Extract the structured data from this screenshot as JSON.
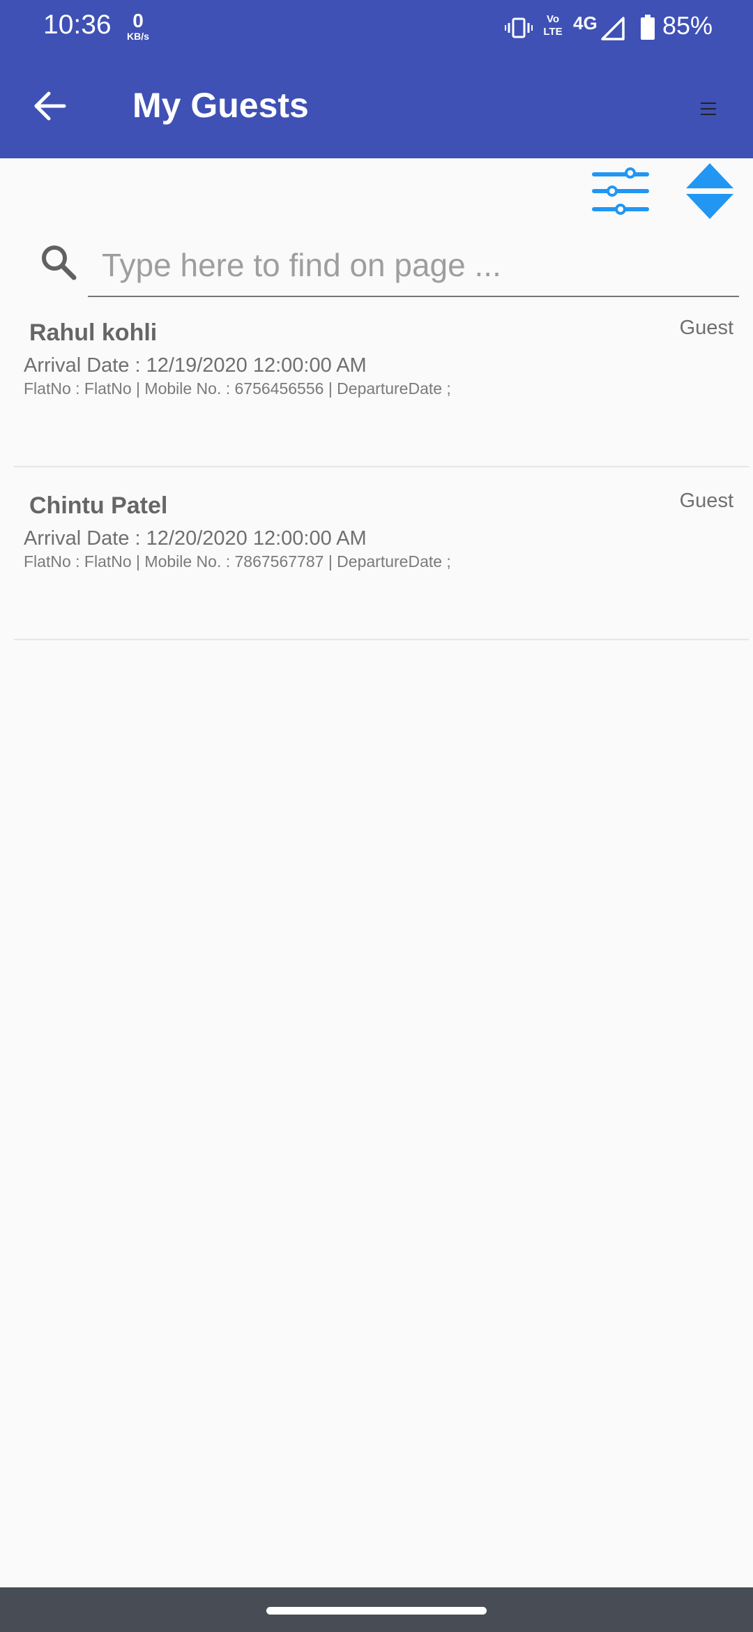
{
  "status_bar": {
    "time": "10:36",
    "net_speed_value": "0",
    "net_speed_unit": "KB/s",
    "volte_top": "Vo",
    "volte_bottom": "LTE",
    "network_type": "4G",
    "battery_percent": "85%"
  },
  "app_bar": {
    "title": "My Guests",
    "background_color": "#3f51b5"
  },
  "toolbar": {
    "filter_icon": "filter-sliders-icon",
    "sort_icon": "sort-updown-icon",
    "accent_color": "#2196f3"
  },
  "search": {
    "placeholder": "Type here to find on page ..."
  },
  "guests": [
    {
      "name": "Rahul kohli",
      "type": "Guest",
      "arrival": "Arrival Date : 12/19/2020 12:00:00 AM",
      "details": "FlatNo : FlatNo | Mobile No. : 6756456556 | DepartureDate ;"
    },
    {
      "name": "Chintu Patel",
      "type": "Guest",
      "arrival": "Arrival Date : 12/20/2020 12:00:00 AM",
      "details": "FlatNo : FlatNo | Mobile No. : 7867567787 | DepartureDate ;"
    }
  ]
}
